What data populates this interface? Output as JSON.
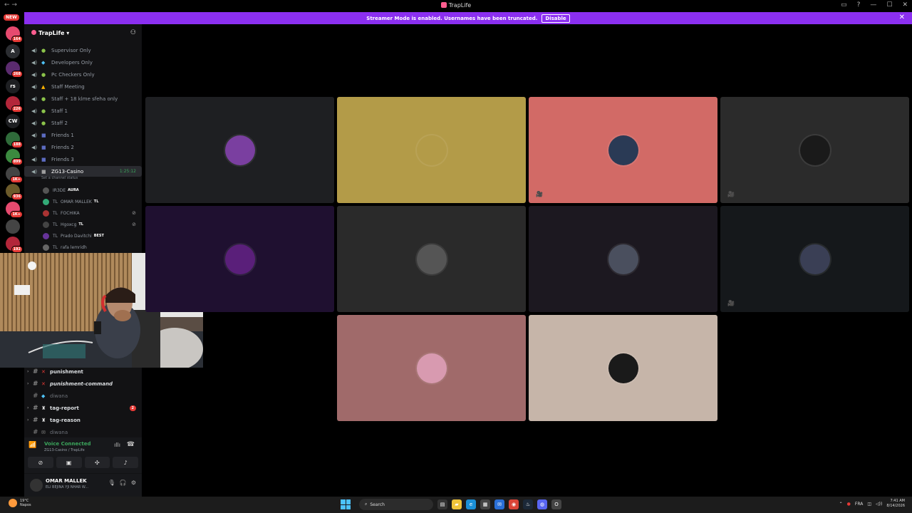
{
  "window": {
    "title": "TrapLife",
    "nav": "← →",
    "controls": [
      "▭",
      "?",
      "—",
      "☐",
      "✕"
    ]
  },
  "banner": {
    "message": "Streamer Mode is enabled. Usernames have been truncated.",
    "action": "Disable"
  },
  "rail": {
    "new_label": "NEW",
    "servers": [
      {
        "label": "",
        "badge": "164",
        "color": "#e64a6f"
      },
      {
        "label": "A",
        "badge": "",
        "color": "#2b2d31"
      },
      {
        "label": "",
        "badge": "268",
        "color": "#5b2b6e"
      },
      {
        "label": "rs",
        "badge": "",
        "color": "#1e1f22"
      },
      {
        "label": "",
        "badge": "226",
        "color": "#b3263a"
      },
      {
        "label": "CW",
        "badge": "",
        "color": "#1e1f22"
      },
      {
        "label": "",
        "badge": "188",
        "color": "#2f6b3a"
      },
      {
        "label": "",
        "badge": "899",
        "color": "#3b8a3f"
      },
      {
        "label": "",
        "badge": "1K+",
        "color": "#444"
      },
      {
        "label": "",
        "badge": "936",
        "color": "#6b5a2a"
      },
      {
        "label": "",
        "badge": "1K+",
        "color": "#e64a6f"
      },
      {
        "label": "",
        "badge": "",
        "color": "#444"
      },
      {
        "label": "",
        "badge": "192",
        "color": "#b3263a"
      },
      {
        "label": "2",
        "badge": "",
        "color": "#1e1f22"
      },
      {
        "label": "",
        "badge": "",
        "color": "#444"
      },
      {
        "label": "",
        "badge": "90",
        "color": "#2b2d31"
      },
      {
        "label": "",
        "badge": "",
        "color": "#b3263a"
      },
      {
        "label": "",
        "badge": "2K+",
        "color": "#333"
      }
    ]
  },
  "server": {
    "name": "TrapLife",
    "chevron": "▾"
  },
  "voice_channels": [
    {
      "marker": "●",
      "marker_color": "#8bc34a",
      "name": "Supervisor Only"
    },
    {
      "marker": "◆",
      "marker_color": "#4fc3f7",
      "name": "Developers Only"
    },
    {
      "marker": "●",
      "marker_color": "#8bc34a",
      "name": "Pc Checkers Only"
    },
    {
      "marker": "▲",
      "marker_color": "#ffb300",
      "name": "Staff Meeting"
    },
    {
      "marker": "●",
      "marker_color": "#8bc34a",
      "name": "Staff + 18 klme sfeha only"
    },
    {
      "marker": "●",
      "marker_color": "#8bc34a",
      "name": "Staff 1"
    },
    {
      "marker": "●",
      "marker_color": "#8bc34a",
      "name": "Staff 2"
    },
    {
      "marker": "■",
      "marker_color": "#5c6bc0",
      "name": "Friends 1"
    },
    {
      "marker": "■",
      "marker_color": "#5c6bc0",
      "name": "Friends 2"
    },
    {
      "marker": "■",
      "marker_color": "#5c6bc0",
      "name": "Friends 3"
    },
    {
      "marker": "■",
      "marker_color": "#9e9e9e",
      "name": "ZG13-Casino",
      "active": true,
      "timer": "1:25:12"
    }
  ],
  "channel_status": "Set a channel status",
  "voice_users": [
    {
      "prefix": "",
      "name": "IR3DE",
      "tag": "AURA"
    },
    {
      "prefix": "TL",
      "name": "OMAR MALLEK",
      "tag": "TL"
    },
    {
      "prefix": "TL",
      "name": "FOCHIKA",
      "tag": ""
    },
    {
      "prefix": "TL",
      "name": "Hgoxcg",
      "tag": "TL"
    },
    {
      "prefix": "TL",
      "name": "Prado Davitchi",
      "tag": "BEST"
    },
    {
      "prefix": "TL",
      "name": "rafa lemridh",
      "tag": ""
    }
  ],
  "text_channels": [
    {
      "name": "punishment",
      "marker": "✕",
      "marker_color": "#e53935",
      "dim": false,
      "mention": ""
    },
    {
      "name": "punishment-command",
      "marker": "✕",
      "marker_color": "#e53935",
      "dim": false,
      "mention": ""
    },
    {
      "name": "diwana",
      "marker": "◆",
      "marker_color": "#4fc3f7",
      "dim": true,
      "mention": ""
    },
    {
      "name": "tag-report",
      "marker": "♜",
      "marker_color": "#ddd",
      "dim": false,
      "mention": "2"
    },
    {
      "name": "tag-reason",
      "marker": "♜",
      "marker_color": "#ddd",
      "dim": false,
      "mention": ""
    },
    {
      "name": "diwana",
      "marker": "✉",
      "marker_color": "#888",
      "dim": true,
      "mention": ""
    }
  ],
  "voice_panel": {
    "status": "Voice Connected",
    "channel": "ZG13-Casino / TrapLife"
  },
  "user_panel": {
    "name": "OMAR MALLEK",
    "status": "ELI BEJINA YJI NHAR W..."
  },
  "tiles": [
    {
      "bg": "#1e1f22",
      "avatar": "#7a3fa0",
      "icon": ""
    },
    {
      "bg": "#b39b48",
      "avatar": "#b39b48",
      "icon": ""
    },
    {
      "bg": "#d26a66",
      "avatar": "#2a3a55",
      "icon": "🎥"
    },
    {
      "bg": "#2b2b2b",
      "avatar": "#1a1a1a",
      "icon": "🎥"
    },
    {
      "bg": "#1f1030",
      "avatar": "#5a1f7a",
      "icon": ""
    },
    {
      "bg": "#2a2a2a",
      "avatar": "#555555",
      "icon": ""
    },
    {
      "bg": "#1c1820",
      "avatar": "#4a4f5e",
      "icon": ""
    },
    {
      "bg": "#15181b",
      "avatar": "#3a3f55",
      "icon": "🎥"
    },
    {
      "bg": "#a06a6a",
      "avatar": "#d89ab0",
      "icon": ""
    },
    {
      "bg": "#c6b5a9",
      "avatar": "#1a1a1a",
      "icon": ""
    }
  ],
  "taskbar": {
    "temp": "19°C",
    "place": "Napos",
    "search": "Search",
    "lang": "FRA",
    "time": "7:41 AM",
    "date": "8/14/2026"
  }
}
